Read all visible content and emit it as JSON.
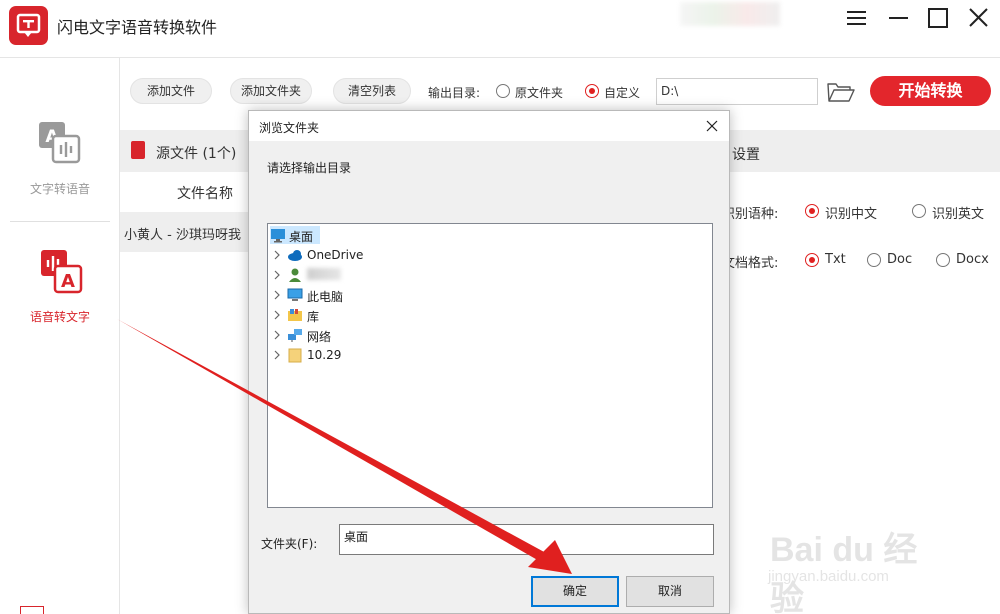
{
  "app": {
    "title": "闪电文字语音转换软件"
  },
  "sidebar": {
    "items": [
      {
        "label": "文字转语音",
        "active": false
      },
      {
        "label": "语音转文字",
        "active": true
      }
    ]
  },
  "toolbar": {
    "add_file": "添加文件",
    "add_folder": "添加文件夹",
    "clear_list": "清空列表",
    "output_label": "输出目录:",
    "opt_original": "原文件夹",
    "opt_custom": "自定义",
    "selected_option": "自定义",
    "output_path": "D:\\",
    "start": "开始转换"
  },
  "file_list": {
    "header": "源文件 (1个)",
    "col_name": "文件名称",
    "rows": [
      "小黄人 - 沙琪玛呀我"
    ]
  },
  "settings": {
    "header": "设置",
    "lang_label": "识别语种:",
    "lang_cn": "识别中文",
    "lang_en": "识别英文",
    "lang_selected": "识别中文",
    "format_label": "文档格式:",
    "fmt_txt": "Txt",
    "fmt_doc": "Doc",
    "fmt_docx": "Docx",
    "fmt_selected": "Txt"
  },
  "dialog": {
    "title": "浏览文件夹",
    "prompt": "请选择输出目录",
    "tree": [
      {
        "label": "桌面",
        "icon": "desktop-icon",
        "selected": true,
        "expandable": false
      },
      {
        "label": "OneDrive",
        "icon": "cloud-icon",
        "selected": false,
        "expandable": true
      },
      {
        "label": "",
        "icon": "user-icon",
        "selected": false,
        "expandable": true
      },
      {
        "label": "此电脑",
        "icon": "computer-icon",
        "selected": false,
        "expandable": true
      },
      {
        "label": "库",
        "icon": "library-icon",
        "selected": false,
        "expandable": true
      },
      {
        "label": "网络",
        "icon": "network-icon",
        "selected": false,
        "expandable": true
      },
      {
        "label": "10.29",
        "icon": "folder-icon",
        "selected": false,
        "expandable": true
      }
    ],
    "folder_label": "文件夹(F):",
    "folder_value": "桌面",
    "ok": "确定",
    "cancel": "取消"
  },
  "watermark": {
    "brand": "Bai du 经验",
    "url": "jingyan.baidu.com"
  },
  "colors": {
    "accent": "#e3262c",
    "selection": "#cce8ff",
    "dialog_bg": "#f0f0f0"
  }
}
